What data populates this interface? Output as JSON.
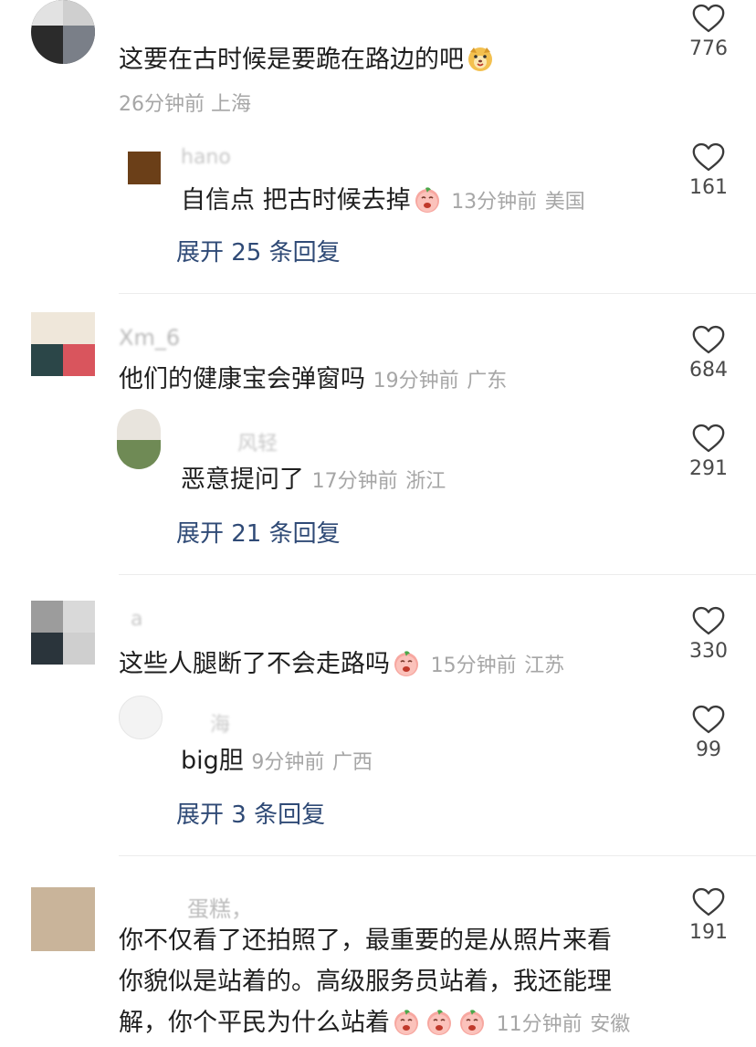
{
  "comments": [
    {
      "id": "c1",
      "username": "",
      "text": "这要在古时候是要跪在路边的吧",
      "emoji": "puppy-emoji",
      "time": "26分钟前",
      "location": "上海",
      "likes": "776",
      "reply": {
        "username": "hano",
        "text": "自信点 把古时候去掉",
        "emoji": "crying-peach-emoji",
        "time": "13分钟前",
        "location": "美国",
        "likes": "161"
      },
      "expand_label": "展开 25 条回复"
    },
    {
      "id": "c2",
      "username": "Xm_6",
      "text": "他们的健康宝会弹窗吗",
      "time": "19分钟前",
      "location": "广东",
      "likes": "684",
      "reply": {
        "username": "风轻",
        "text": "恶意提问了",
        "time": "17分钟前",
        "location": "浙江",
        "likes": "291"
      },
      "expand_label": "展开 21 条回复"
    },
    {
      "id": "c3",
      "username": "a",
      "text": "这些人腿断了不会走路吗",
      "emoji": "laughing-peach-emoji",
      "time": "15分钟前",
      "location": "江苏",
      "likes": "330",
      "reply": {
        "username": "海",
        "text": "big胆",
        "time": "9分钟前",
        "location": "广西",
        "likes": "99"
      },
      "expand_label": "展开 3 条回复"
    },
    {
      "id": "c4",
      "username": "蛋糕，",
      "lines": [
        "你不仅看了还拍照了，最重要的是从照片来看",
        "你貌似是站着的。高级服务员站着，我还能理",
        "解，你个平民为什么站着"
      ],
      "emoji": "thinking-peach-emoji x3",
      "time": "11分钟前",
      "location": "安徽",
      "likes": "191"
    }
  ],
  "colors": {
    "expand": "#2f4a76",
    "meta": "#a6a6a6",
    "text": "#1f1f1f"
  }
}
